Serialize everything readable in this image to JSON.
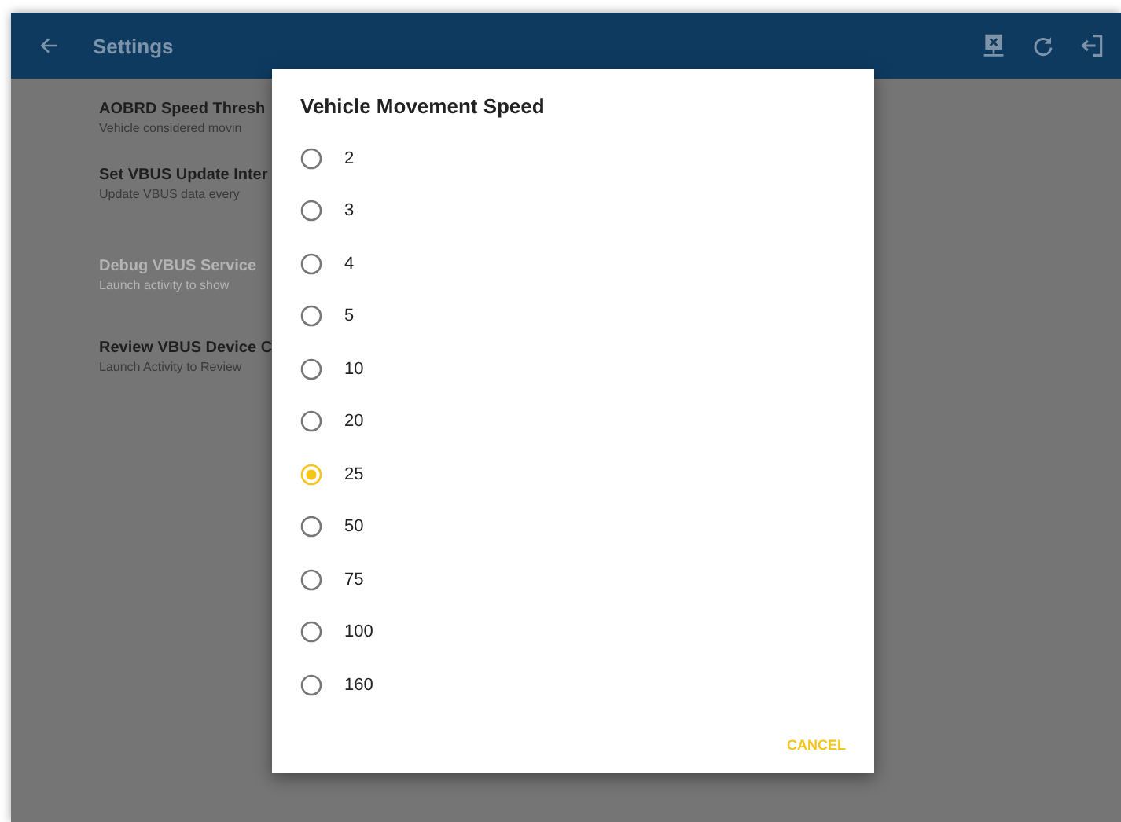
{
  "app_bar": {
    "title": "Settings"
  },
  "settings": [
    {
      "title": "AOBRD Speed Thresh",
      "summary": "Vehicle considered movin",
      "disabled": false
    },
    {
      "title": "Set VBUS Update Inter",
      "summary": "Update VBUS data every",
      "disabled": false
    },
    {
      "title": "Debug VBUS Service",
      "summary": "Launch activity to show",
      "disabled": true
    },
    {
      "title": "Review VBUS Device C",
      "summary": "Launch Activity to Review",
      "disabled": false
    }
  ],
  "dialog": {
    "title": "Vehicle Movement Speed",
    "options": [
      {
        "label": "2",
        "selected": false
      },
      {
        "label": "3",
        "selected": false
      },
      {
        "label": "4",
        "selected": false
      },
      {
        "label": "5",
        "selected": false
      },
      {
        "label": "10",
        "selected": false
      },
      {
        "label": "20",
        "selected": false
      },
      {
        "label": "25",
        "selected": true
      },
      {
        "label": "50",
        "selected": false
      },
      {
        "label": "75",
        "selected": false
      },
      {
        "label": "100",
        "selected": false
      },
      {
        "label": "160",
        "selected": false
      }
    ],
    "button": "CANCEL"
  }
}
